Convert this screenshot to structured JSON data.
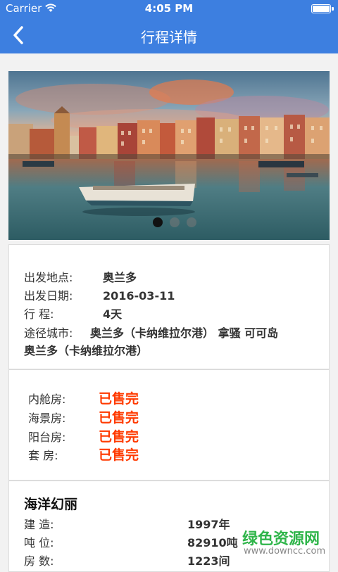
{
  "status": {
    "carrier": "Carrier",
    "time": "4:05 PM"
  },
  "header": {
    "title": "行程详情"
  },
  "banner": {
    "slide_count": 3,
    "active_slide": 1
  },
  "trip": {
    "depart_place_label": "出发地点:",
    "depart_place": "奥兰多",
    "depart_date_label": "出发日期:",
    "depart_date": "2016-03-11",
    "duration_label": "行      程:",
    "duration": "4天",
    "route_label": "途径城市:",
    "route_line1": "奥兰多（卡纳维拉尔港） 拿骚 可可岛",
    "route_line2": "奥兰多（卡纳维拉尔港）"
  },
  "rooms": [
    {
      "label": "内舱房:",
      "status": "已售完"
    },
    {
      "label": "海景房:",
      "status": "已售完"
    },
    {
      "label": "阳台房:",
      "status": "已售完"
    },
    {
      "label": "套    房:",
      "status": "已售完"
    }
  ],
  "ship": {
    "name": "海洋幻丽",
    "built_label": "建      造:",
    "built": "1997年",
    "tonnage_label": "吨      位:",
    "tonnage": "82910吨",
    "rooms_label": "房      数:",
    "rooms": "1223间"
  },
  "watermark": {
    "text": "绿色资源网",
    "url": "www.downcc.com"
  },
  "colors": {
    "primary": "#3d7fe0",
    "sold_out": "#ff3a00"
  }
}
